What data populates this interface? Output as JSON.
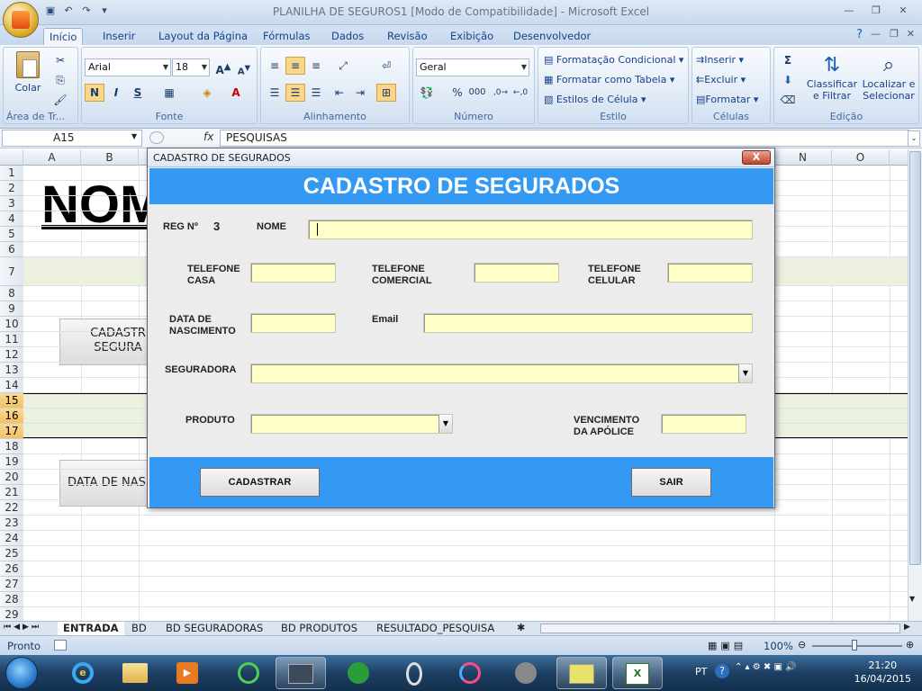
{
  "app": {
    "window_title": "PLANILHA DE SEGUROS1  [Modo de Compatibilidade] - Microsoft Excel"
  },
  "ribbon": {
    "tabs": [
      "Início",
      "Inserir",
      "Layout da Página",
      "Fórmulas",
      "Dados",
      "Revisão",
      "Exibição",
      "Desenvolvedor"
    ],
    "active_tab": "Início",
    "groups": {
      "clipboard": {
        "label": "Área de Tr...",
        "paste": "Colar"
      },
      "font": {
        "label": "Fonte",
        "family": "Arial",
        "size": "18",
        "bold": "N",
        "italic": "I",
        "underline": "S"
      },
      "alignment": {
        "label": "Alinhamento"
      },
      "number": {
        "label": "Número",
        "format": "Geral",
        "percent": "%",
        "thousands": "000",
        "inc_decimals": ",0​0",
        "dec_decimals": ",00"
      },
      "styles": {
        "label": "Estilo",
        "cond_format": "Formatação Condicional",
        "format_table": "Formatar como Tabela",
        "cell_styles": "Estilos de Célula"
      },
      "cells": {
        "label": "Células",
        "insert": "Inserir",
        "delete": "Excluir",
        "format": "Formatar"
      },
      "editing": {
        "label": "Edição",
        "sort_filter_1": "Classificar",
        "sort_filter_2": "e Filtrar",
        "find_select_1": "Localizar e",
        "find_select_2": "Selecionar"
      }
    }
  },
  "formula_bar": {
    "name_box": "A15",
    "fx": "fx",
    "value": "PESQUISAS"
  },
  "sheet": {
    "columns": [
      "A",
      "B",
      "N",
      "O"
    ],
    "rows": [
      "1",
      "2",
      "3",
      "4",
      "5",
      "6",
      "7",
      "8",
      "9",
      "10",
      "11",
      "12",
      "13",
      "14",
      "15",
      "16",
      "17",
      "18",
      "19",
      "20",
      "21",
      "22",
      "23",
      "24",
      "25",
      "26",
      "27",
      "28",
      "29"
    ],
    "big_text": "NOM",
    "cad_btn_1": "CADASTR",
    "cad_btn_2": "SEGURA",
    "dob_btn": "DATA DE NAS"
  },
  "sheet_tabs": [
    "ENTRADA",
    "BD",
    "BD SEGURADORAS",
    "BD PRODUTOS",
    "RESULTADO_PESQUISA"
  ],
  "active_sheet": "ENTRADA",
  "status": {
    "ready": "Pronto",
    "zoom": "100%"
  },
  "taskbar": {
    "lang": "PT",
    "time": "21:20",
    "date": "16/04/2015"
  },
  "dialog": {
    "title": "CADASTRO DE SEGURADOS",
    "heading": "CADASTRO DE SEGURADOS",
    "reg_label": "REG Nº",
    "reg_value": "3",
    "nome": "NOME",
    "tel_casa_1": "TELEFONE",
    "tel_casa_2": "CASA",
    "tel_com_1": "TELEFONE",
    "tel_com_2": "COMERCIAL",
    "tel_cel_1": "TELEFONE",
    "tel_cel_2": "CELULAR",
    "data_nasc_1": "DATA DE",
    "data_nasc_2": "NASCIMENTO",
    "email": "Email",
    "seguradora": "SEGURADORA",
    "produto": "PRODUTO",
    "venc_1": "VENCIMENTO",
    "venc_2": "DA APÓLICE",
    "cadastrar": "CADASTRAR",
    "sair": "SAIR",
    "close": "X"
  }
}
